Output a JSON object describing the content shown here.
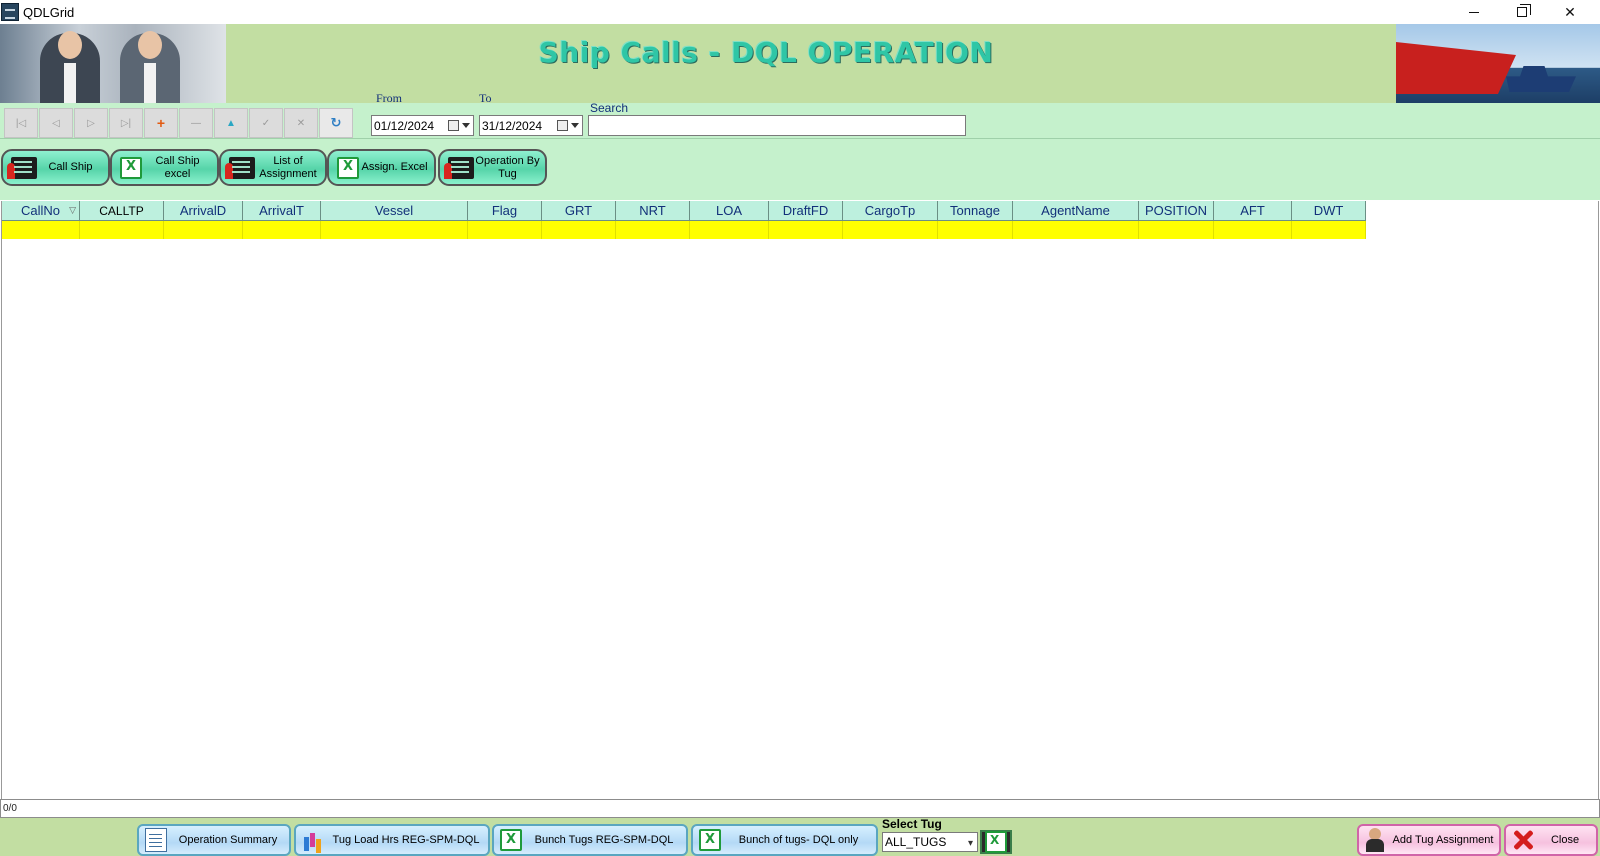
{
  "window": {
    "title": "QDLGrid"
  },
  "header": {
    "title": "Ship Calls - DQL OPERATION"
  },
  "filters": {
    "from_label": "From",
    "to_label": "To",
    "search_label": "Search",
    "from_date": "01/12/2024",
    "to_date": "31/12/2024",
    "search_value": ""
  },
  "nav_buttons": [
    {
      "name": "first-record",
      "glyph": "|◁"
    },
    {
      "name": "prev-record",
      "glyph": "◁"
    },
    {
      "name": "next-record",
      "glyph": "▷"
    },
    {
      "name": "last-record",
      "glyph": "▷|"
    },
    {
      "name": "add-record",
      "glyph": "+"
    },
    {
      "name": "delete-record",
      "glyph": "—"
    },
    {
      "name": "edit-record",
      "glyph": "▲"
    },
    {
      "name": "post-record",
      "glyph": "✓"
    },
    {
      "name": "cancel-record",
      "glyph": "✕"
    },
    {
      "name": "refresh-record",
      "glyph": "↻"
    }
  ],
  "actions": {
    "call_ship": "Call Ship",
    "call_ship_excel": "Call Ship excel",
    "list_of_assignment": "List of Assignment",
    "assign_excel": "Assign. Excel",
    "operation_by_tug": "Operation By Tug"
  },
  "grid": {
    "columns": [
      "CallNo",
      "CALLTP",
      "ArrivalD",
      "ArrivalT",
      "Vessel",
      "Flag",
      "GRT",
      "NRT",
      "LOA",
      "DraftFD",
      "CargoTp",
      "Tonnage",
      "AgentName",
      "POSITION",
      "AFT",
      "DWT"
    ],
    "rows": []
  },
  "status": {
    "record_count": "0/0"
  },
  "bottom": {
    "operation_summary": "Operation Summary",
    "tug_load_hrs": "Tug Load Hrs REG-SPM-DQL",
    "bunch_tugs": "Bunch Tugs REG-SPM-DQL",
    "bunch_of_tugs_dql": "Bunch of tugs- DQL only",
    "select_tug_label": "Select Tug",
    "select_tug_value": "ALL_TUGS",
    "add_tug_assignment": "Add Tug Assignment",
    "close": "Close"
  }
}
